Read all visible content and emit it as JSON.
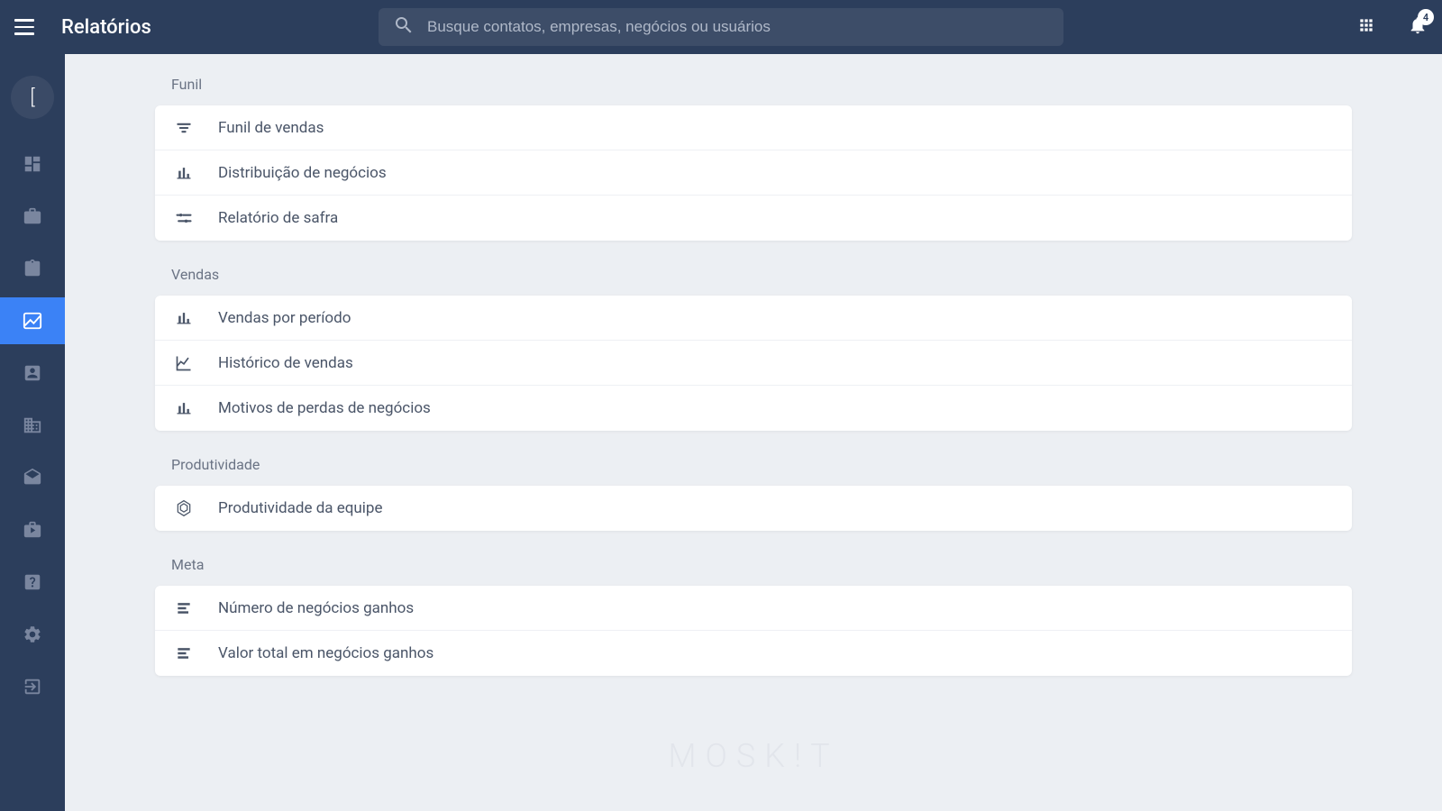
{
  "header": {
    "title": "Relatórios",
    "search_placeholder": "Busque contatos, empresas, negócios ou usuários",
    "notification_count": "4"
  },
  "avatar": {
    "initial": "["
  },
  "sections": {
    "funil": {
      "label": "Funil",
      "items": {
        "funil_vendas": "Funil de vendas",
        "distribuicao": "Distribuição de negócios",
        "safra": "Relatório de safra"
      }
    },
    "vendas": {
      "label": "Vendas",
      "items": {
        "periodo": "Vendas por período",
        "historico": "Histórico de vendas",
        "perdas": "Motivos de perdas de negócios"
      }
    },
    "produtividade": {
      "label": "Produtividade",
      "items": {
        "equipe": "Produtividade da equipe"
      }
    },
    "meta": {
      "label": "Meta",
      "items": {
        "numero": "Número de negócios ganhos",
        "valor": "Valor total em negócios ganhos"
      }
    }
  },
  "watermark": "MOSK!T"
}
